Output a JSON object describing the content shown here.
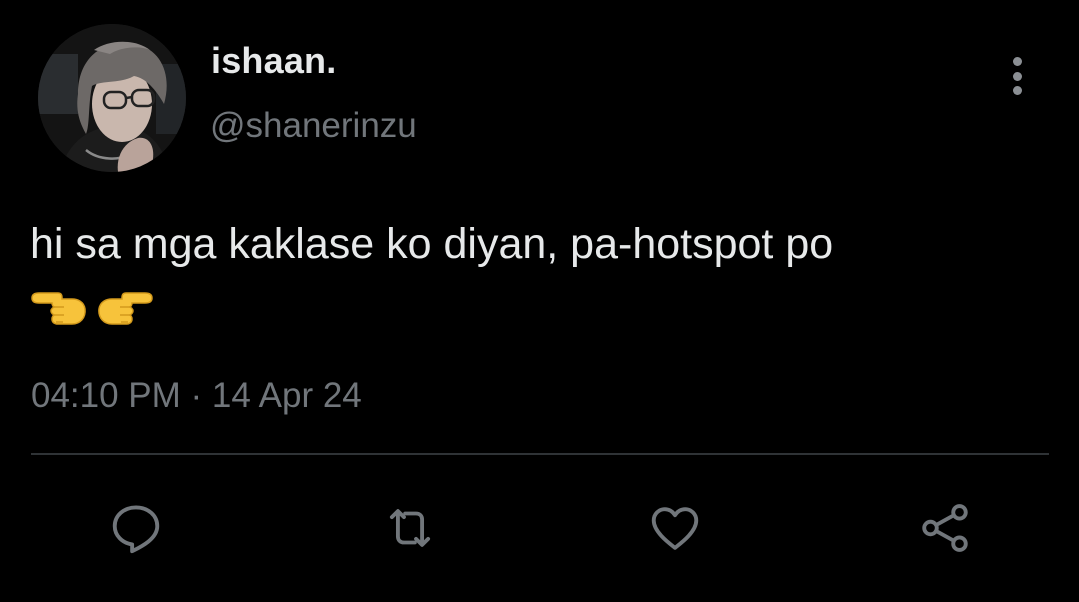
{
  "tweet": {
    "author": {
      "display_name": "ishaan.",
      "handle": "@shanerinzu",
      "avatar_icon": "profile-photo"
    },
    "text": "hi sa mga kaklase ko diyan, pa-hotspot po",
    "emojis": [
      "backhand-index-pointing-left",
      "backhand-index-pointing-right"
    ],
    "timestamp": "04:10 PM · 14 Apr 24"
  },
  "actions": [
    {
      "name": "reply",
      "icon": "comment-bubble-icon"
    },
    {
      "name": "retweet",
      "icon": "retweet-icon"
    },
    {
      "name": "like",
      "icon": "heart-icon"
    },
    {
      "name": "share",
      "icon": "share-icon"
    }
  ],
  "colors": {
    "background": "#000000",
    "primary_text": "#e7e9ea",
    "secondary_text": "#71767b",
    "divider": "#2f3336",
    "icon": "#71767b"
  }
}
